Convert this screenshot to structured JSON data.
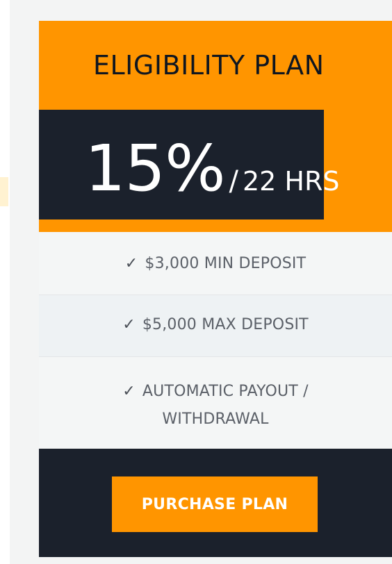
{
  "plan": {
    "title": "ELIGIBILITY PLAN",
    "rate_percent": "15%",
    "rate_separator": "/",
    "rate_duration": "22 HRS"
  },
  "features": [
    {
      "icon": "checkmark-icon",
      "icon_glyph": "✓",
      "text": "$3,000 MIN DEPOSIT"
    },
    {
      "icon": "checkmark-icon",
      "icon_glyph": "✓",
      "text": "$5,000 MAX DEPOSIT"
    },
    {
      "icon": "checkmark-icon",
      "icon_glyph": "✓",
      "text_line1": "AUTOMATIC PAYOUT /",
      "text_line2": "WITHDRAWAL"
    }
  ],
  "actions": {
    "purchase_label": "PURCHASE PLAN"
  },
  "colors": {
    "accent": "#ff9500",
    "dark": "#1b212c",
    "light_bg": "#f4f6f6",
    "feature_text": "#5b6068"
  }
}
